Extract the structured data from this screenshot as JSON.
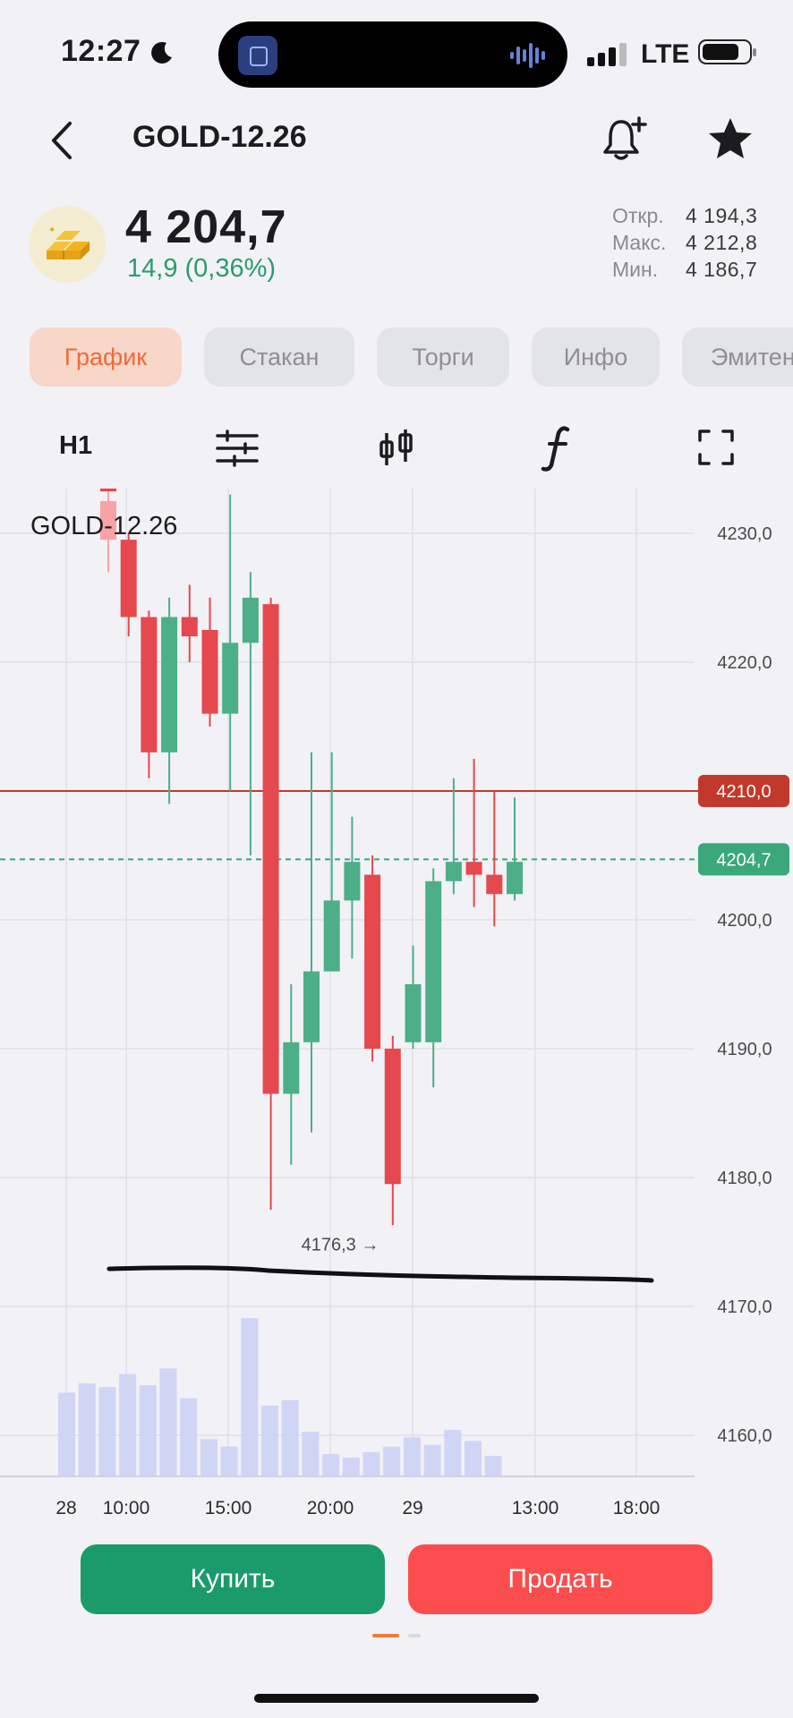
{
  "status": {
    "time": "12:27",
    "network": "LTE"
  },
  "header": {
    "title": "GOLD-12.26"
  },
  "quote": {
    "price": "4 204,7",
    "change": "14,9 (0,36%)",
    "stats": [
      {
        "label": "Откр.",
        "value": "4 194,3"
      },
      {
        "label": "Макс.",
        "value": "4 212,8"
      },
      {
        "label": "Мин.",
        "value": "4 186,7"
      }
    ]
  },
  "tabs": [
    "График",
    "Стакан",
    "Торги",
    "Инфо",
    "Эмитент"
  ],
  "toolbar": {
    "timeframe": "H1"
  },
  "chart": {
    "name": "GOLD-12.26",
    "level_line": "4210,0",
    "last_price": "4204,7",
    "min_marker": "4176,3 →"
  },
  "chart_data": {
    "type": "candlestick",
    "title": "GOLD-12.26",
    "y_ticks": [
      "4230,0",
      "4220,0",
      "4210,0",
      "4200,0",
      "4190,0",
      "4180,0",
      "4170,0",
      "4160,0"
    ],
    "x_ticks": [
      "28",
      "10:00",
      "15:00",
      "20:00",
      "29",
      "13:00",
      "18:00"
    ],
    "ylim": [
      4157,
      4233
    ],
    "candles": [
      {
        "open": 4232.5,
        "close": 4229.5,
        "high": 4235,
        "low": 4227
      },
      {
        "open": 4229.5,
        "close": 4223.5,
        "high": 4230,
        "low": 4222
      },
      {
        "open": 4223.5,
        "close": 4213,
        "high": 4224,
        "low": 4211
      },
      {
        "open": 4213,
        "close": 4223.5,
        "high": 4225,
        "low": 4209
      },
      {
        "open": 4223.5,
        "close": 4222,
        "high": 4226,
        "low": 4220
      },
      {
        "open": 4222.5,
        "close": 4216,
        "high": 4225,
        "low": 4215
      },
      {
        "open": 4216,
        "close": 4221.5,
        "high": 4233,
        "low": 4210
      },
      {
        "open": 4221.5,
        "close": 4225,
        "high": 4227,
        "low": 4205
      },
      {
        "open": 4224.5,
        "close": 4186.5,
        "high": 4225,
        "low": 4177.5
      },
      {
        "open": 4186.5,
        "close": 4190.5,
        "high": 4195,
        "low": 4181
      },
      {
        "open": 4190.5,
        "close": 4196,
        "high": 4213,
        "low": 4183.5
      },
      {
        "open": 4196,
        "close": 4201.5,
        "high": 4213,
        "low": 4196
      },
      {
        "open": 4201.5,
        "close": 4204.5,
        "high": 4208,
        "low": 4197
      },
      {
        "open": 4203.5,
        "close": 4190,
        "high": 4205,
        "low": 4189
      },
      {
        "open": 4190,
        "close": 4179.5,
        "high": 4191,
        "low": 4176.3
      },
      {
        "open": 4190.5,
        "close": 4195,
        "high": 4198,
        "low": 4190
      },
      {
        "open": 4190.5,
        "close": 4203,
        "high": 4204,
        "low": 4187
      },
      {
        "open": 4203,
        "close": 4204.5,
        "high": 4211,
        "low": 4202
      },
      {
        "open": 4204.5,
        "close": 4203.5,
        "high": 4212.5,
        "low": 4201
      },
      {
        "open": 4203.5,
        "close": 4202,
        "high": 4210,
        "low": 4199.5
      },
      {
        "open": 4202,
        "close": 4204.5,
        "high": 4209.5,
        "low": 4201.5
      }
    ],
    "volumes": [
      0.5,
      0.48,
      0.55,
      0.49,
      0.58,
      0.42,
      0.2,
      0.16,
      0.85,
      0.38,
      0.41,
      0.24,
      0.12,
      0.1,
      0.13,
      0.16,
      0.21,
      0.17,
      0.25,
      0.19,
      0.11
    ],
    "first_bar_volume": 0.45,
    "hline_price": 4210.0,
    "last_price": 4204.7,
    "colors": {
      "up": "#4caf88",
      "down": "#e5484d",
      "volume": "#cbd0f4",
      "hline": "#c0392b",
      "last": "#3aa87a"
    }
  },
  "actions": {
    "buy": "Купить",
    "sell": "Продать"
  }
}
